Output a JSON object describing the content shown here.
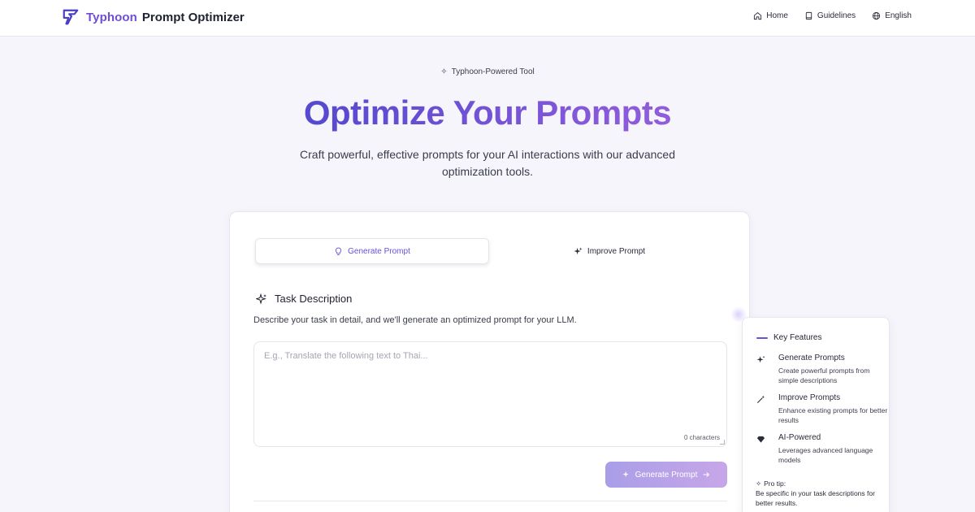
{
  "header": {
    "brand_name": "Typhoon",
    "brand_suffix": "Prompt Optimizer",
    "nav": [
      {
        "label": "Home",
        "icon": "home-icon"
      },
      {
        "label": "Guidelines",
        "icon": "book-icon"
      },
      {
        "label": "English",
        "icon": "globe-icon"
      }
    ]
  },
  "hero": {
    "badge": "Typhoon-Powered Tool",
    "title": "Optimize Your Prompts",
    "subtitle": "Craft powerful, effective prompts for your AI interactions with our advanced optimization tools."
  },
  "tabs": [
    {
      "label": "Generate Prompt",
      "icon": "lightbulb-icon",
      "active": true
    },
    {
      "label": "Improve Prompt",
      "icon": "sparkles-icon",
      "active": false
    }
  ],
  "task": {
    "title": "Task Description",
    "description": "Describe your task in detail, and we'll generate an optimized prompt for your LLM.",
    "placeholder": "E.g., Translate the following text to Thai...",
    "value": "",
    "char_count": "0 characters",
    "button_label": "Generate Prompt"
  },
  "features": {
    "title": "Key Features",
    "items": [
      {
        "name": "Generate Prompts",
        "desc": "Create powerful prompts from simple descriptions",
        "icon": "sparkles-icon"
      },
      {
        "name": "Improve Prompts",
        "desc": "Enhance existing prompts for better results",
        "icon": "wand-icon"
      },
      {
        "name": "AI-Powered",
        "desc": "Leverages advanced language models",
        "icon": "gem-icon"
      }
    ],
    "tip_label": "Pro tip:",
    "tip_text": "Be specific in your task descriptions for better results."
  },
  "colors": {
    "accent": "#6651d8",
    "title_gradient_start": "#3f44c6",
    "title_gradient_end": "#b066df",
    "button_gradient_start": "#a99ee8",
    "button_gradient_end": "#c7a6e8",
    "background": "#f6f5fb"
  }
}
